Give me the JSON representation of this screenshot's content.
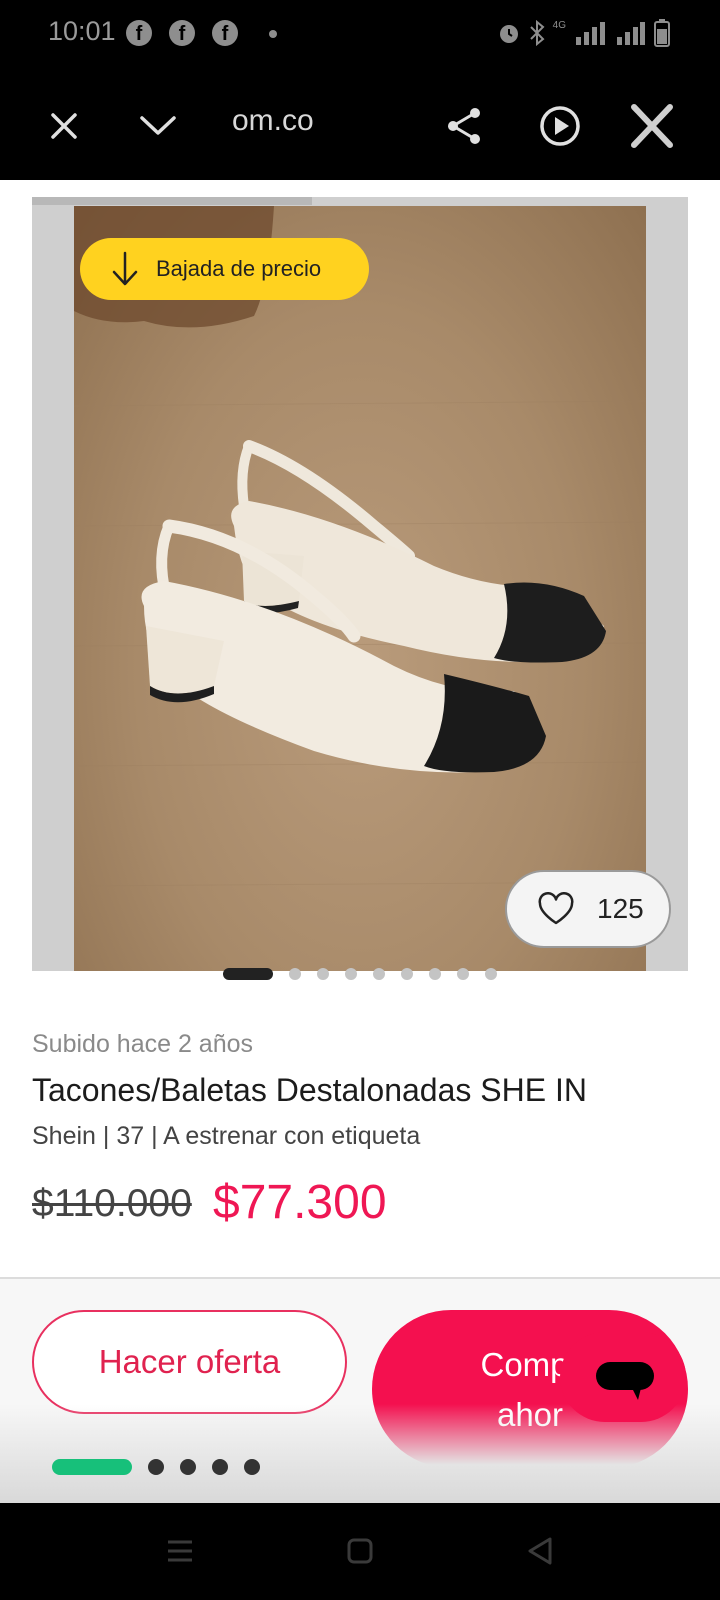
{
  "status_bar": {
    "time": "10:01",
    "notification_icons": [
      "facebook-icon",
      "facebook-icon",
      "facebook-icon"
    ],
    "network_label": "4G"
  },
  "browser": {
    "url": "om.co",
    "icons": [
      "close-icon",
      "chevron-down-icon",
      "share-icon",
      "play-icon",
      "x-logo-icon"
    ]
  },
  "product": {
    "badge": "Bajada de precio",
    "likes": "125",
    "image_count": 9,
    "active_image": 1,
    "uploaded": "Subido hace 2 años",
    "title": "Tacones/Baletas Destalonadas SHE IN",
    "details": "Shein | 37 | A estrenar con etiqueta",
    "old_price": "$110.000",
    "new_price": "$77.300"
  },
  "actions": {
    "offer_label": "Hacer oferta",
    "buy_line1": "Compr",
    "buy_line2": "ahor"
  },
  "colors": {
    "accent": "#f4104f",
    "badge": "#ffd21f",
    "progress": "#17c07a"
  },
  "progress": {
    "steps": 5,
    "current": 1
  }
}
